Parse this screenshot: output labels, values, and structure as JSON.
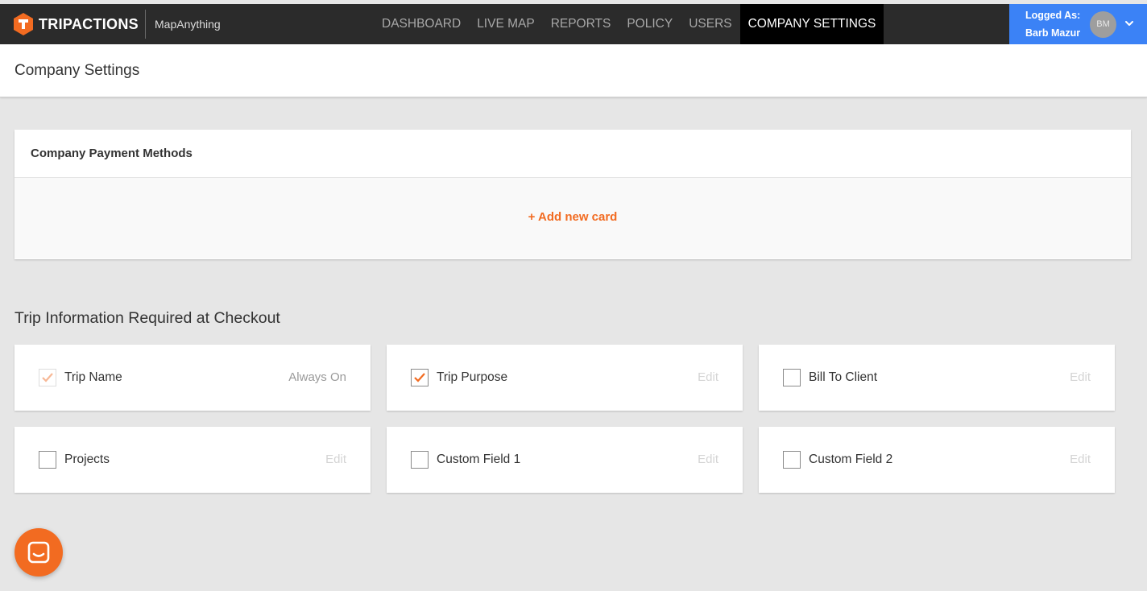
{
  "brand": {
    "logo_text": "TRIPACTIONS",
    "company": "MapAnything",
    "accent": "#f26b21",
    "nav_bg": "#2b2b2b",
    "user_bg": "#3b82f6"
  },
  "nav": {
    "items": [
      {
        "label": "DASHBOARD",
        "active": false
      },
      {
        "label": "LIVE MAP",
        "active": false
      },
      {
        "label": "REPORTS",
        "active": false
      },
      {
        "label": "POLICY",
        "active": false
      },
      {
        "label": "USERS",
        "active": false
      },
      {
        "label": "COMPANY SETTINGS",
        "active": true
      }
    ]
  },
  "user": {
    "label": "Logged As:",
    "name": "Barb Mazur",
    "initials": "BM",
    "menu_icon": "chevron-down-icon"
  },
  "page": {
    "title": "Company Settings"
  },
  "payment": {
    "title": "Company Payment Methods",
    "add_label": "+ Add new card"
  },
  "checkout": {
    "title": "Trip Information Required at Checkout",
    "fields": [
      {
        "label": "Trip Name",
        "checked": true,
        "disabled": true,
        "action": "Always On"
      },
      {
        "label": "Trip Purpose",
        "checked": true,
        "disabled": false,
        "action": "Edit"
      },
      {
        "label": "Bill To Client",
        "checked": false,
        "disabled": false,
        "action": "Edit"
      },
      {
        "label": "Projects",
        "checked": false,
        "disabled": false,
        "action": "Edit"
      },
      {
        "label": "Custom Field 1",
        "checked": false,
        "disabled": false,
        "action": "Edit"
      },
      {
        "label": "Custom Field 2",
        "checked": false,
        "disabled": false,
        "action": "Edit"
      }
    ]
  },
  "chat": {
    "icon": "chat-icon"
  }
}
